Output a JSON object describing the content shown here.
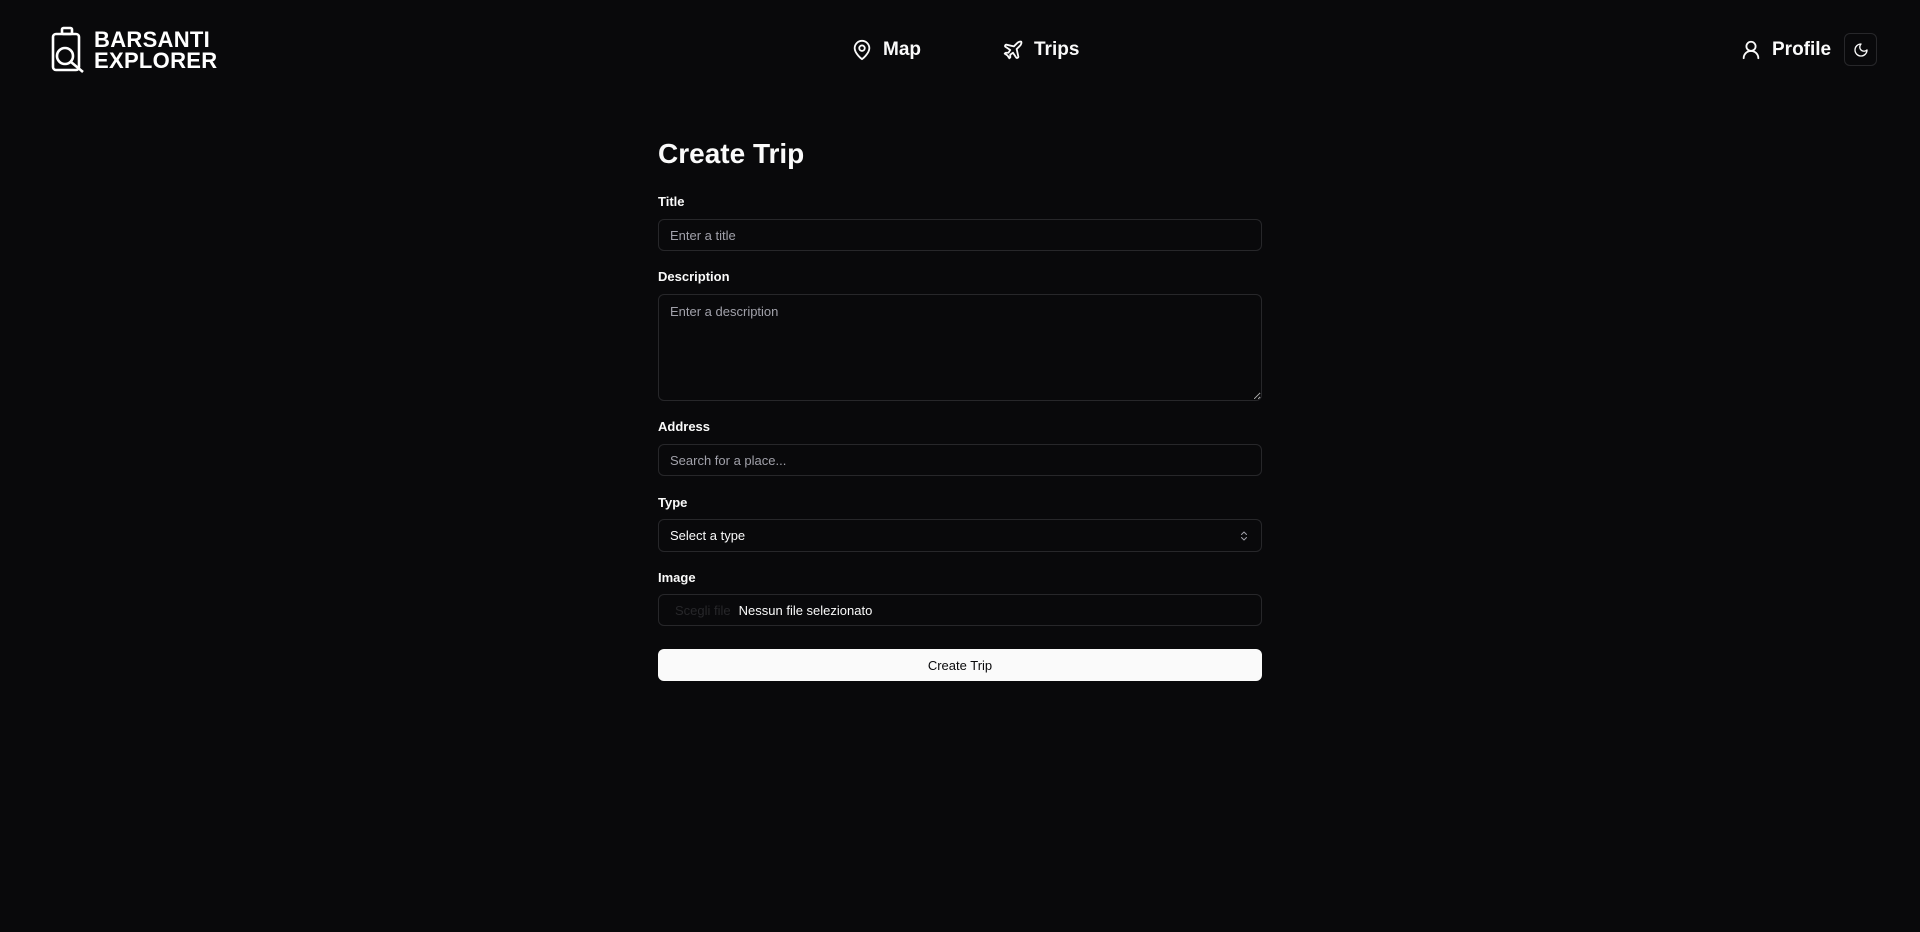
{
  "brand": {
    "line1": "BARSANTI",
    "line2": "EXPLORER"
  },
  "nav": {
    "map": "Map",
    "trips": "Trips",
    "profile": "Profile"
  },
  "page": {
    "title": "Create Trip"
  },
  "form": {
    "title_label": "Title",
    "title_placeholder": "Enter a title",
    "description_label": "Description",
    "description_placeholder": "Enter a description",
    "address_label": "Address",
    "address_placeholder": "Search for a place...",
    "type_label": "Type",
    "type_value": "Select a type",
    "image_label": "Image",
    "image_choose": "Scegli file",
    "image_status": "Nessun file selezionato",
    "submit_label": "Create Trip"
  },
  "colors": {
    "background": "#09090b",
    "border": "#27272a",
    "foreground": "#fafafa",
    "muted": "#a1a1aa"
  }
}
